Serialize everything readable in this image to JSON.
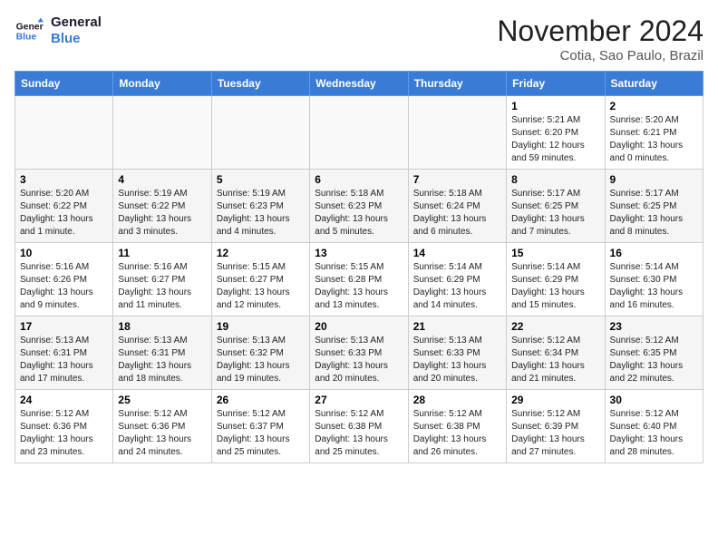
{
  "logo": {
    "line1": "General",
    "line2": "Blue"
  },
  "title": "November 2024",
  "location": "Cotia, Sao Paulo, Brazil",
  "weekdays": [
    "Sunday",
    "Monday",
    "Tuesday",
    "Wednesday",
    "Thursday",
    "Friday",
    "Saturday"
  ],
  "weeks": [
    [
      {
        "day": "",
        "info": ""
      },
      {
        "day": "",
        "info": ""
      },
      {
        "day": "",
        "info": ""
      },
      {
        "day": "",
        "info": ""
      },
      {
        "day": "",
        "info": ""
      },
      {
        "day": "1",
        "info": "Sunrise: 5:21 AM\nSunset: 6:20 PM\nDaylight: 12 hours and 59 minutes."
      },
      {
        "day": "2",
        "info": "Sunrise: 5:20 AM\nSunset: 6:21 PM\nDaylight: 13 hours and 0 minutes."
      }
    ],
    [
      {
        "day": "3",
        "info": "Sunrise: 5:20 AM\nSunset: 6:22 PM\nDaylight: 13 hours and 1 minute."
      },
      {
        "day": "4",
        "info": "Sunrise: 5:19 AM\nSunset: 6:22 PM\nDaylight: 13 hours and 3 minutes."
      },
      {
        "day": "5",
        "info": "Sunrise: 5:19 AM\nSunset: 6:23 PM\nDaylight: 13 hours and 4 minutes."
      },
      {
        "day": "6",
        "info": "Sunrise: 5:18 AM\nSunset: 6:23 PM\nDaylight: 13 hours and 5 minutes."
      },
      {
        "day": "7",
        "info": "Sunrise: 5:18 AM\nSunset: 6:24 PM\nDaylight: 13 hours and 6 minutes."
      },
      {
        "day": "8",
        "info": "Sunrise: 5:17 AM\nSunset: 6:25 PM\nDaylight: 13 hours and 7 minutes."
      },
      {
        "day": "9",
        "info": "Sunrise: 5:17 AM\nSunset: 6:25 PM\nDaylight: 13 hours and 8 minutes."
      }
    ],
    [
      {
        "day": "10",
        "info": "Sunrise: 5:16 AM\nSunset: 6:26 PM\nDaylight: 13 hours and 9 minutes."
      },
      {
        "day": "11",
        "info": "Sunrise: 5:16 AM\nSunset: 6:27 PM\nDaylight: 13 hours and 11 minutes."
      },
      {
        "day": "12",
        "info": "Sunrise: 5:15 AM\nSunset: 6:27 PM\nDaylight: 13 hours and 12 minutes."
      },
      {
        "day": "13",
        "info": "Sunrise: 5:15 AM\nSunset: 6:28 PM\nDaylight: 13 hours and 13 minutes."
      },
      {
        "day": "14",
        "info": "Sunrise: 5:14 AM\nSunset: 6:29 PM\nDaylight: 13 hours and 14 minutes."
      },
      {
        "day": "15",
        "info": "Sunrise: 5:14 AM\nSunset: 6:29 PM\nDaylight: 13 hours and 15 minutes."
      },
      {
        "day": "16",
        "info": "Sunrise: 5:14 AM\nSunset: 6:30 PM\nDaylight: 13 hours and 16 minutes."
      }
    ],
    [
      {
        "day": "17",
        "info": "Sunrise: 5:13 AM\nSunset: 6:31 PM\nDaylight: 13 hours and 17 minutes."
      },
      {
        "day": "18",
        "info": "Sunrise: 5:13 AM\nSunset: 6:31 PM\nDaylight: 13 hours and 18 minutes."
      },
      {
        "day": "19",
        "info": "Sunrise: 5:13 AM\nSunset: 6:32 PM\nDaylight: 13 hours and 19 minutes."
      },
      {
        "day": "20",
        "info": "Sunrise: 5:13 AM\nSunset: 6:33 PM\nDaylight: 13 hours and 20 minutes."
      },
      {
        "day": "21",
        "info": "Sunrise: 5:13 AM\nSunset: 6:33 PM\nDaylight: 13 hours and 20 minutes."
      },
      {
        "day": "22",
        "info": "Sunrise: 5:12 AM\nSunset: 6:34 PM\nDaylight: 13 hours and 21 minutes."
      },
      {
        "day": "23",
        "info": "Sunrise: 5:12 AM\nSunset: 6:35 PM\nDaylight: 13 hours and 22 minutes."
      }
    ],
    [
      {
        "day": "24",
        "info": "Sunrise: 5:12 AM\nSunset: 6:36 PM\nDaylight: 13 hours and 23 minutes."
      },
      {
        "day": "25",
        "info": "Sunrise: 5:12 AM\nSunset: 6:36 PM\nDaylight: 13 hours and 24 minutes."
      },
      {
        "day": "26",
        "info": "Sunrise: 5:12 AM\nSunset: 6:37 PM\nDaylight: 13 hours and 25 minutes."
      },
      {
        "day": "27",
        "info": "Sunrise: 5:12 AM\nSunset: 6:38 PM\nDaylight: 13 hours and 25 minutes."
      },
      {
        "day": "28",
        "info": "Sunrise: 5:12 AM\nSunset: 6:38 PM\nDaylight: 13 hours and 26 minutes."
      },
      {
        "day": "29",
        "info": "Sunrise: 5:12 AM\nSunset: 6:39 PM\nDaylight: 13 hours and 27 minutes."
      },
      {
        "day": "30",
        "info": "Sunrise: 5:12 AM\nSunset: 6:40 PM\nDaylight: 13 hours and 28 minutes."
      }
    ]
  ]
}
